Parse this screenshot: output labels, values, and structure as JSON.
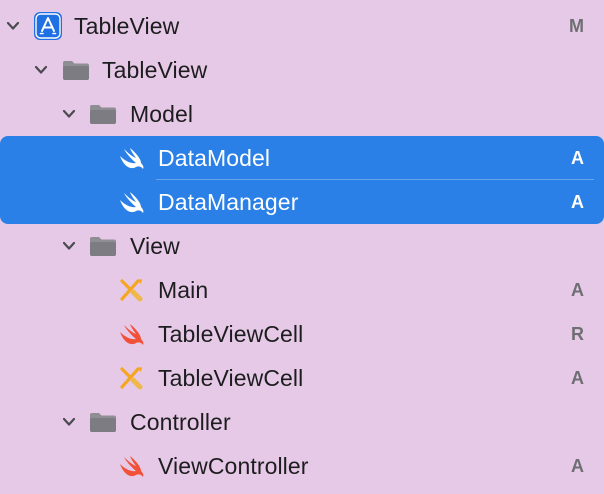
{
  "navigator": {
    "rows": [
      {
        "label": "TableView",
        "status": "M"
      },
      {
        "label": "TableView",
        "status": ""
      },
      {
        "label": "Model",
        "status": ""
      },
      {
        "label": "DataModel",
        "status": "A"
      },
      {
        "label": "DataManager",
        "status": "A"
      },
      {
        "label": "View",
        "status": ""
      },
      {
        "label": "Main",
        "status": "A"
      },
      {
        "label": "TableViewCell",
        "status": "R"
      },
      {
        "label": "TableViewCell",
        "status": "A"
      },
      {
        "label": "Controller",
        "status": ""
      },
      {
        "label": "ViewController",
        "status": "A"
      }
    ]
  },
  "icons": {
    "project": "xcode-project-icon",
    "folder": "folder-icon",
    "swift": "swift-file-icon",
    "xib": "interface-builder-file-icon",
    "disclosure": "chevron-down-icon"
  },
  "colors": {
    "background": "#e6c9e6",
    "selection": "#2a80e6",
    "swift": "#f05138",
    "xib": "#f5a623",
    "project": "#1f6fe5",
    "folder": "#8e8e93",
    "badge": "#6e6e73"
  }
}
